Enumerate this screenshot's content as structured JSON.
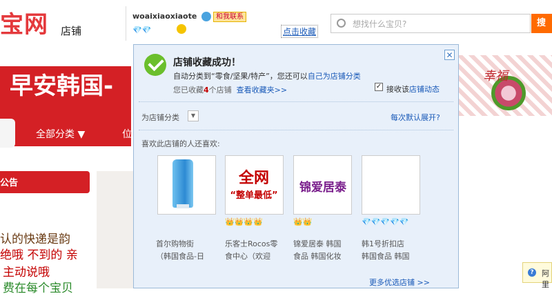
{
  "shop": {
    "logo_text": "宝网",
    "logo_suffix": "店铺",
    "banner_title": "早安韩国-",
    "banner_deco": "幸福",
    "nav_all": "全部分类 ▼",
    "nav_more": "位",
    "notice_label": "公告",
    "notice_lines": [
      {
        "text": "认的快递是韵",
        "color": "#6a3b14"
      },
      {
        "text": "绝哦 不到的 亲",
        "color": "#c40000"
      },
      {
        "text": "主动说哦",
        "color": "#c40000"
      },
      {
        "text": "费在每个宝贝",
        "color": "#2a8a2a"
      }
    ]
  },
  "user": {
    "username": "woaixiaoxiaote",
    "contact_label": "和我联系",
    "diamonds": "💎💎",
    "favorite_label": "点击收藏"
  },
  "search": {
    "placeholder": "想找什么宝贝?",
    "button_label": "搜"
  },
  "popup": {
    "close_label": "✕",
    "title": "店铺收藏成功！",
    "category_prefix": "自动分类到“零食/坚果/特产”，您还可以",
    "category_link": "自己为店铺分类",
    "collected_prefix": "您已收藏",
    "collected_count": "4",
    "collected_suffix": "个店铺",
    "view_favorites_link": "查看收藏夹>>",
    "receive_checked": true,
    "receive_prefix": "接收该",
    "receive_link": "店铺动态",
    "category_select_label": "为店铺分类",
    "expand_link": "每次默认展开?",
    "also_like_label": "喜欢此店铺的人还喜欢:",
    "more_link": "更多优选店铺 >>",
    "products": [
      {
        "name_line1": "首尔购物街",
        "name_line2": "（韩国食品-日",
        "rating": "",
        "image_text": ""
      },
      {
        "name_line1": "乐客士Rocos零",
        "name_line2": "食中心（欢迎",
        "rating": "👑👑👑👑",
        "image_text": "全网",
        "image_subtext": "“整单最低”"
      },
      {
        "name_line1": "锦爱居泰 韩国",
        "name_line2": "食品 韩国化妆",
        "rating": "👑👑",
        "image_text": "锦爱居泰"
      },
      {
        "name_line1": "韩1号折扣店",
        "name_line2": "韩国食品 韩国",
        "rating": "💎💎💎💎💎",
        "image_text": ""
      }
    ]
  },
  "chat": {
    "icon": "?",
    "text": "阿里"
  }
}
